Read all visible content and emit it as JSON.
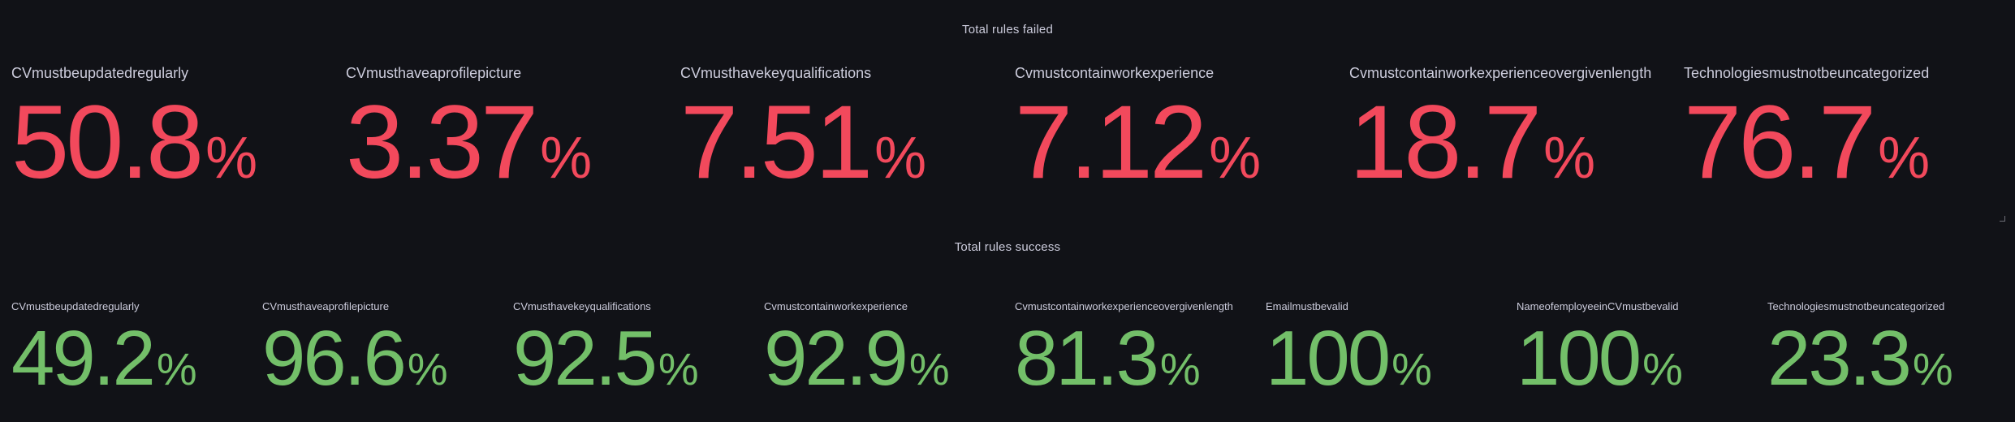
{
  "panels": {
    "failed": {
      "title": "Total rules failed",
      "color": "#f2495c",
      "stats": [
        {
          "name": "CVmustbeupdatedregularly",
          "value": "50.8",
          "unit": "%"
        },
        {
          "name": "CVmusthaveaprofilepicture",
          "value": "3.37",
          "unit": "%"
        },
        {
          "name": "CVmusthavekeyqualifications",
          "value": "7.51",
          "unit": "%"
        },
        {
          "name": "Cvmustcontainworkexperience",
          "value": "7.12",
          "unit": "%"
        },
        {
          "name": "Cvmustcontainworkexperienceovergivenlength",
          "value": "18.7",
          "unit": "%"
        },
        {
          "name": "Technologiesmustnotbeuncategorized",
          "value": "76.7",
          "unit": "%"
        }
      ]
    },
    "success": {
      "title": "Total rules success",
      "color": "#73bf69",
      "stats": [
        {
          "name": "CVmustbeupdatedregularly",
          "value": "49.2",
          "unit": "%"
        },
        {
          "name": "CVmusthaveaprofilepicture",
          "value": "96.6",
          "unit": "%"
        },
        {
          "name": "CVmusthavekeyqualifications",
          "value": "92.5",
          "unit": "%"
        },
        {
          "name": "Cvmustcontainworkexperience",
          "value": "92.9",
          "unit": "%"
        },
        {
          "name": "Cvmustcontainworkexperienceovergivenlength",
          "value": "81.3",
          "unit": "%"
        },
        {
          "name": "Emailmustbevalid",
          "value": "100",
          "unit": "%"
        },
        {
          "name": "NameofemployeeinCVmustbevalid",
          "value": "100",
          "unit": "%"
        },
        {
          "name": "Technologiesmustnotbeuncategorized",
          "value": "23.3",
          "unit": "%"
        }
      ]
    }
  }
}
